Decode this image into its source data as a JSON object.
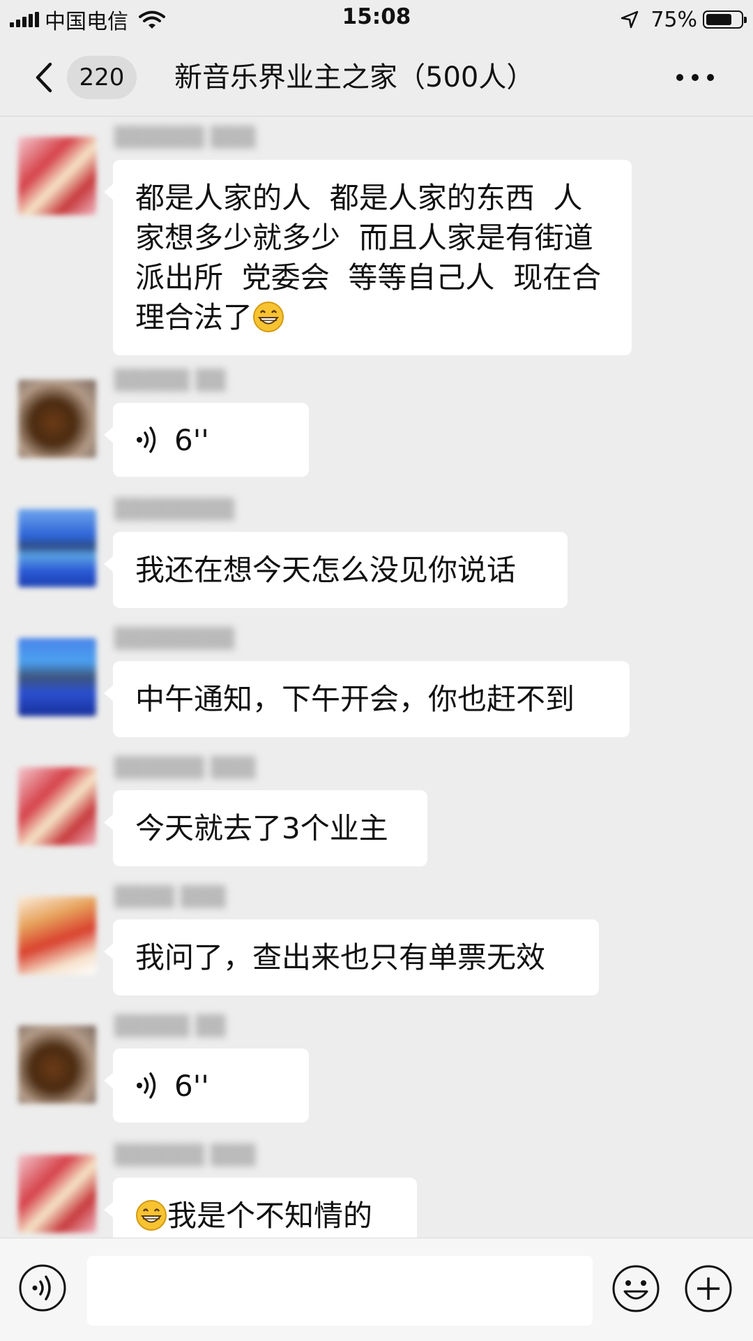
{
  "status_bar": {
    "carrier": "中国电信",
    "time": "15:08",
    "battery_percent": "75%",
    "battery_level": 0.75
  },
  "nav": {
    "unread_count": "220",
    "title": "新音乐界业主之家（500人）",
    "back_icon": "chevron-left-icon",
    "more_icon": "more-dots-icon"
  },
  "messages": [
    {
      "type": "text",
      "avatar": "blurred-photo-pink-red",
      "text": "都是人家的人  都是人家的东西  人家想多少就多少  而且人家是有街道  派出所  党委会  等等自己人  现在合理合法了",
      "trailing_emoji": "grin-emoji"
    },
    {
      "type": "voice",
      "avatar": "blurred-photo-brown",
      "duration": "6''"
    },
    {
      "type": "text",
      "avatar": "blurred-photo-blue",
      "text": "我还在想今天怎么没见你说话"
    },
    {
      "type": "text",
      "avatar": "blurred-photo-blue-dark",
      "text": "中午通知，下午开会，你也赶不到"
    },
    {
      "type": "text",
      "avatar": "blurred-photo-pink-red",
      "text": "今天就去了3个业主"
    },
    {
      "type": "text",
      "avatar": "blurred-photo-orange",
      "text": "我问了，查出来也只有单票无效"
    },
    {
      "type": "voice",
      "avatar": "blurred-photo-brown",
      "duration": "6''"
    },
    {
      "type": "text",
      "avatar": "blurred-photo-pink-red",
      "leading_emoji": "grin-emoji",
      "text": "我是个不知情的"
    }
  ],
  "input_bar": {
    "voice_icon": "voice-input-icon",
    "emoji_icon": "smiley-icon",
    "plus_icon": "plus-circle-icon",
    "placeholder": ""
  }
}
